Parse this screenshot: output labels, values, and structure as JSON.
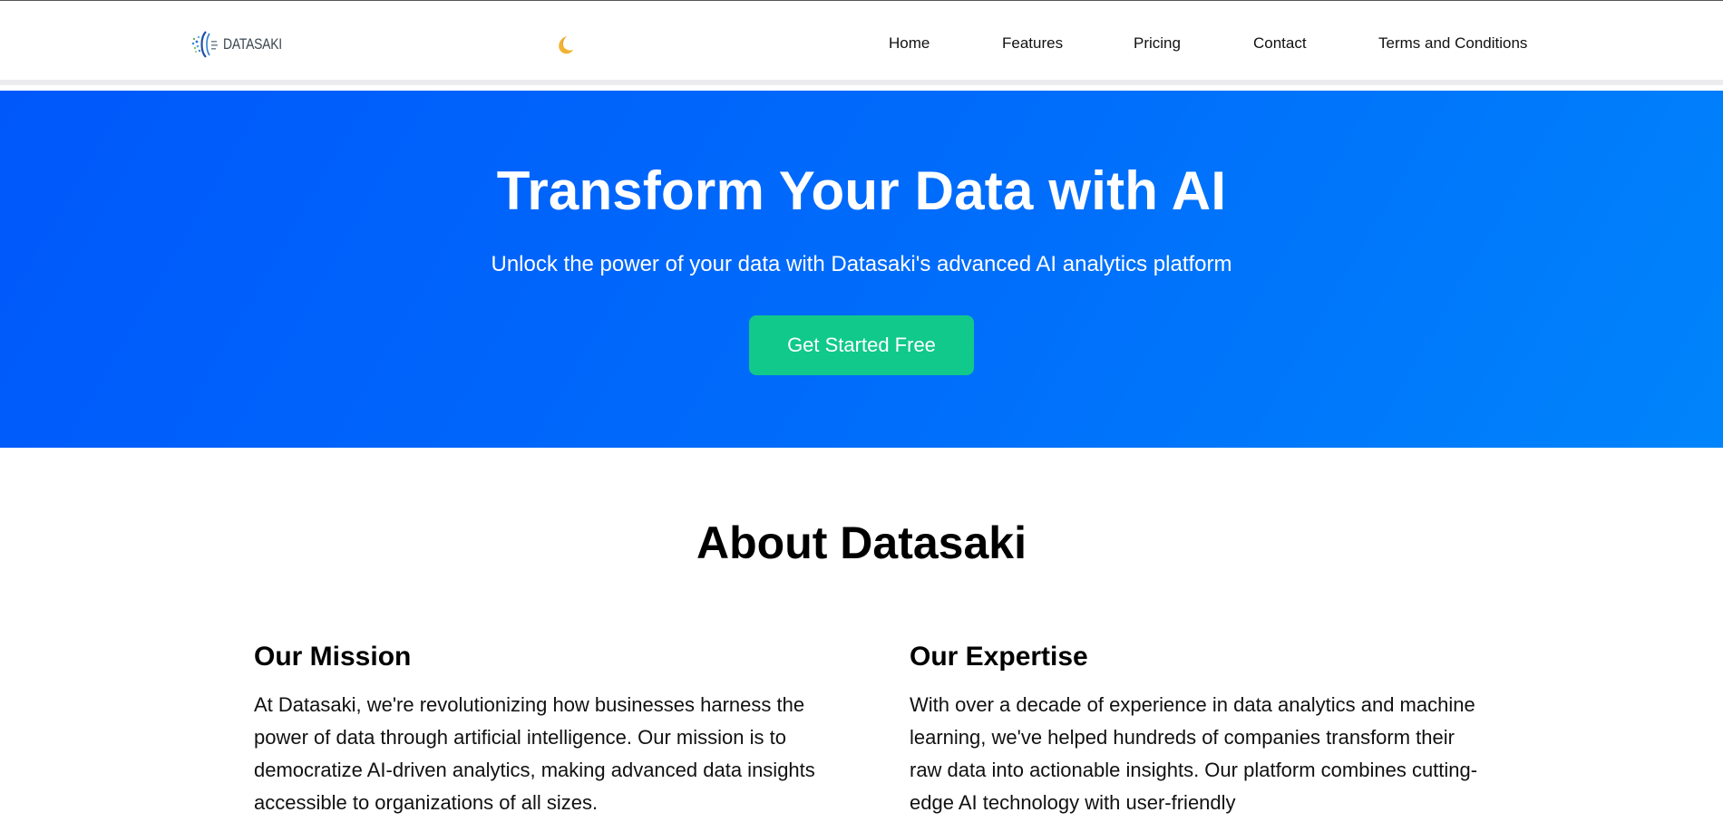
{
  "header": {
    "logo_text": "DATASAKI",
    "theme_toggle_icon": "moon-icon",
    "nav": [
      "Home",
      "Features",
      "Pricing",
      "Contact",
      "Terms and Conditions"
    ]
  },
  "hero": {
    "title": "Transform Your Data with AI",
    "subtitle": "Unlock the power of your data with Datasaki's advanced AI analytics platform",
    "cta_label": "Get Started Free",
    "colors": {
      "gradient_start": "#0058fb",
      "gradient_end": "#0084fb",
      "cta": "#10c98a"
    }
  },
  "about": {
    "title": "About Datasaki",
    "mission": {
      "heading": "Our Mission",
      "body": "At Datasaki, we're revolutionizing how businesses harness the power of data through artificial intelligence. Our mission is to democratize AI-driven analytics, making advanced data insights accessible to organizations of all sizes."
    },
    "expertise": {
      "heading": "Our Expertise",
      "body": "With over a decade of experience in data analytics and machine learning, we've helped hundreds of companies transform their raw data into actionable insights. Our platform combines cutting-edge AI technology with user-friendly"
    }
  }
}
